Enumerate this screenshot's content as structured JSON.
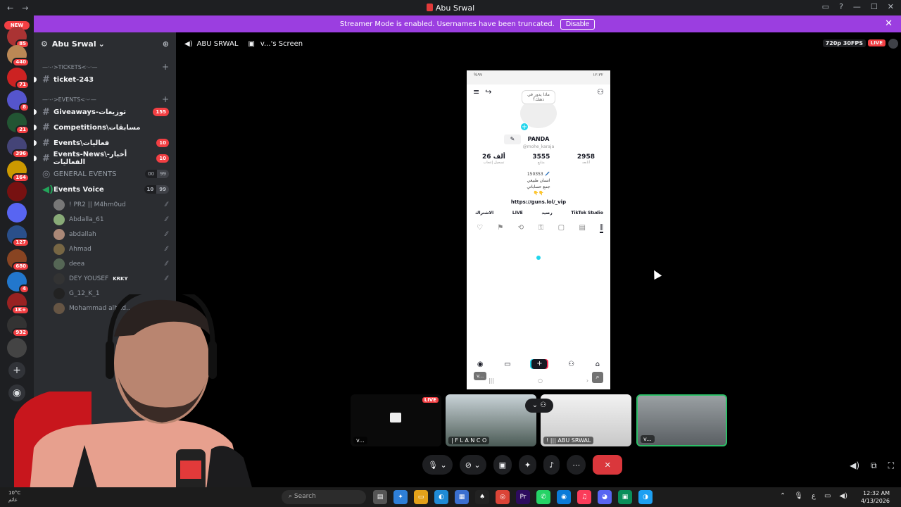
{
  "window": {
    "title": "Abu Srwal"
  },
  "banner": {
    "text": "Streamer Mode is enabled. Usernames have been truncated.",
    "button": "Disable"
  },
  "guilds": {
    "new_label": "NEW",
    "badges": [
      "85",
      "440",
      "71",
      "8",
      "21",
      "396",
      "164",
      "127",
      "680",
      "4",
      "1K+",
      "932"
    ]
  },
  "sidebar": {
    "server_name": "Abu Srwal",
    "categories": [
      {
        "name": "—·-·>TICKETS<·-·—",
        "channels": [
          {
            "name": "ticket-243"
          }
        ]
      },
      {
        "name": "—·-·>EVENTS<·-·—",
        "channels": [
          {
            "name": "Giveaways-توزيعات",
            "badge": "155"
          },
          {
            "name": "Competitions\\مسابقات"
          },
          {
            "name": "Events\\فعاليات",
            "badge": "10"
          },
          {
            "name": "Events-News\\أخبار-الفعاليات",
            "badge": "10"
          }
        ]
      }
    ],
    "general_events": {
      "name": "GENERAL EVENTS",
      "count": "00",
      "limit": "99"
    },
    "voice": {
      "name": "Events Voice",
      "count": "10",
      "limit": "99"
    },
    "voice_users": [
      {
        "name": "! PR2 || M4hm0ud"
      },
      {
        "name": "Abdalla_61"
      },
      {
        "name": "abdallah"
      },
      {
        "name": "Ahmad"
      },
      {
        "name": "deea"
      },
      {
        "name": "DEY YOUSEF",
        "tag": "KRKY"
      },
      {
        "name": "G_12_K_1"
      },
      {
        "name": "Mohammad alhad..."
      }
    ]
  },
  "stage": {
    "call_name": "ABU SRWAL",
    "screen_name": "v...'s Screen",
    "quality": "720p 30FPS",
    "live": "LIVE"
  },
  "phone": {
    "status_left": "%٩٧",
    "status_right": "١٢:٣٢",
    "bubble": "ماذا يدور في ذهنك؟",
    "username": "PANDA",
    "handle": "@mohe_karaja",
    "stats": [
      {
        "value": "26 ألف",
        "label": "تسجيل إعجاب"
      },
      {
        "value": "3555",
        "label": "متابع"
      },
      {
        "value": "2958",
        "label": "أتابعه"
      }
    ],
    "bio": [
      "150353 🖊️",
      "انسان طبيعي",
      "جمع حساباتي",
      "👇👇"
    ],
    "link": "https://guns.lol/_vip",
    "tools": [
      "الاشتراك",
      "LIVE",
      "رصيد",
      "TikTok Studio"
    ],
    "chip": "v..."
  },
  "tiles": [
    {
      "label": "v...",
      "live": "LIVE"
    },
    {
      "label": "| F L A N C O"
    },
    {
      "label": "! ||| ABU SRWAL"
    },
    {
      "label": "v..."
    }
  ],
  "taskbar": {
    "weather": "10°C",
    "weather_sub": "غائم",
    "search": "Search",
    "time": "12:32 AM",
    "date": "4/13/2026",
    "lang": "ع"
  }
}
